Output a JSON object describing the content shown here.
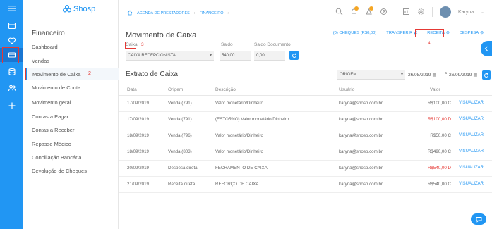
{
  "app": {
    "logo_text": "Shosp"
  },
  "breadcrumb": {
    "items": [
      "AGENDA DE PRESTADORES",
      "FINANCEIRO"
    ]
  },
  "user": {
    "name": "Karyna"
  },
  "sidebar": {
    "title": "Financeiro",
    "items": [
      {
        "label": "Dashboard"
      },
      {
        "label": "Vendas"
      },
      {
        "label": "Movimento de Caixa"
      },
      {
        "label": "Movimento de Conta"
      },
      {
        "label": "Movimento geral"
      },
      {
        "label": "Contas a Pagar"
      },
      {
        "label": "Contas a Receber"
      },
      {
        "label": "Repasse Médico"
      },
      {
        "label": "Conciliação Bancária"
      },
      {
        "label": "Devolução de Cheques"
      }
    ],
    "annotation": "2"
  },
  "page": {
    "title": "Movimento de Caixa",
    "caixa_label": "Caixa",
    "caixa_annotation": "3",
    "caixa_value": "CAIXA RECEPCIONISTA",
    "saldo_label": "Saldo",
    "saldo_value": "540,00",
    "saldo_doc_label": "Saldo Documento",
    "saldo_doc_value": "0,00"
  },
  "actions": {
    "cheques": "(0) CHEQUES (R$0,00)",
    "transferir": "TRANSFERIR",
    "receita": "RECEITA",
    "despesa": "DESPESA",
    "receita_annotation": "4"
  },
  "extrato": {
    "title": "Extrato de Caixa",
    "filter": "ORIGEM",
    "date_from": "26/08/2019",
    "date_to": "26/09/2019",
    "date_sep": "a",
    "columns": [
      "Data",
      "Origem",
      "Descrição",
      "Usuário",
      "Valor"
    ],
    "rows": [
      {
        "data": "17/09/2019",
        "origem": "Venda (791)",
        "descricao": "Valor monetário/Dinheiro",
        "usuario": "karyna@shosp.com.br",
        "valor": "R$100,00 C",
        "negative": false,
        "action": "VISUALIZAR"
      },
      {
        "data": "17/09/2019",
        "origem": "Venda (791)",
        "descricao": "(ESTORNO) Valor monetário/Dinheiro",
        "usuario": "karyna@shosp.com.br",
        "valor": "R$100,00 D",
        "negative": true,
        "action": "VISUALIZAR"
      },
      {
        "data": "18/09/2019",
        "origem": "Venda (796)",
        "descricao": "Valor monetário/Dinheiro",
        "usuario": "karyna@shosp.com.br",
        "valor": "R$50,00 C",
        "negative": false,
        "action": "VISUALIZAR"
      },
      {
        "data": "18/09/2019",
        "origem": "Venda (803)",
        "descricao": "Valor monetário/Dinheiro",
        "usuario": "karyna@shosp.com.br",
        "valor": "R$490,00 C",
        "negative": false,
        "action": "VISUALIZAR"
      },
      {
        "data": "20/09/2019",
        "origem": "Despesa direta",
        "descricao": "FECHAMENTO DE CAIXA",
        "usuario": "karyna@shosp.com.br",
        "valor": "R$540,00 D",
        "negative": true,
        "action": "VISUALIZAR"
      },
      {
        "data": "21/09/2019",
        "origem": "Receita direta",
        "descricao": "REFORÇO DE CAIXA",
        "usuario": "karyna@shosp.com.br",
        "valor": "R$540,00 C",
        "negative": false,
        "action": "VISUALIZAR"
      }
    ]
  },
  "colors": {
    "accent": "#2196f3",
    "highlight": "#e53935",
    "debit": "#e53935"
  }
}
